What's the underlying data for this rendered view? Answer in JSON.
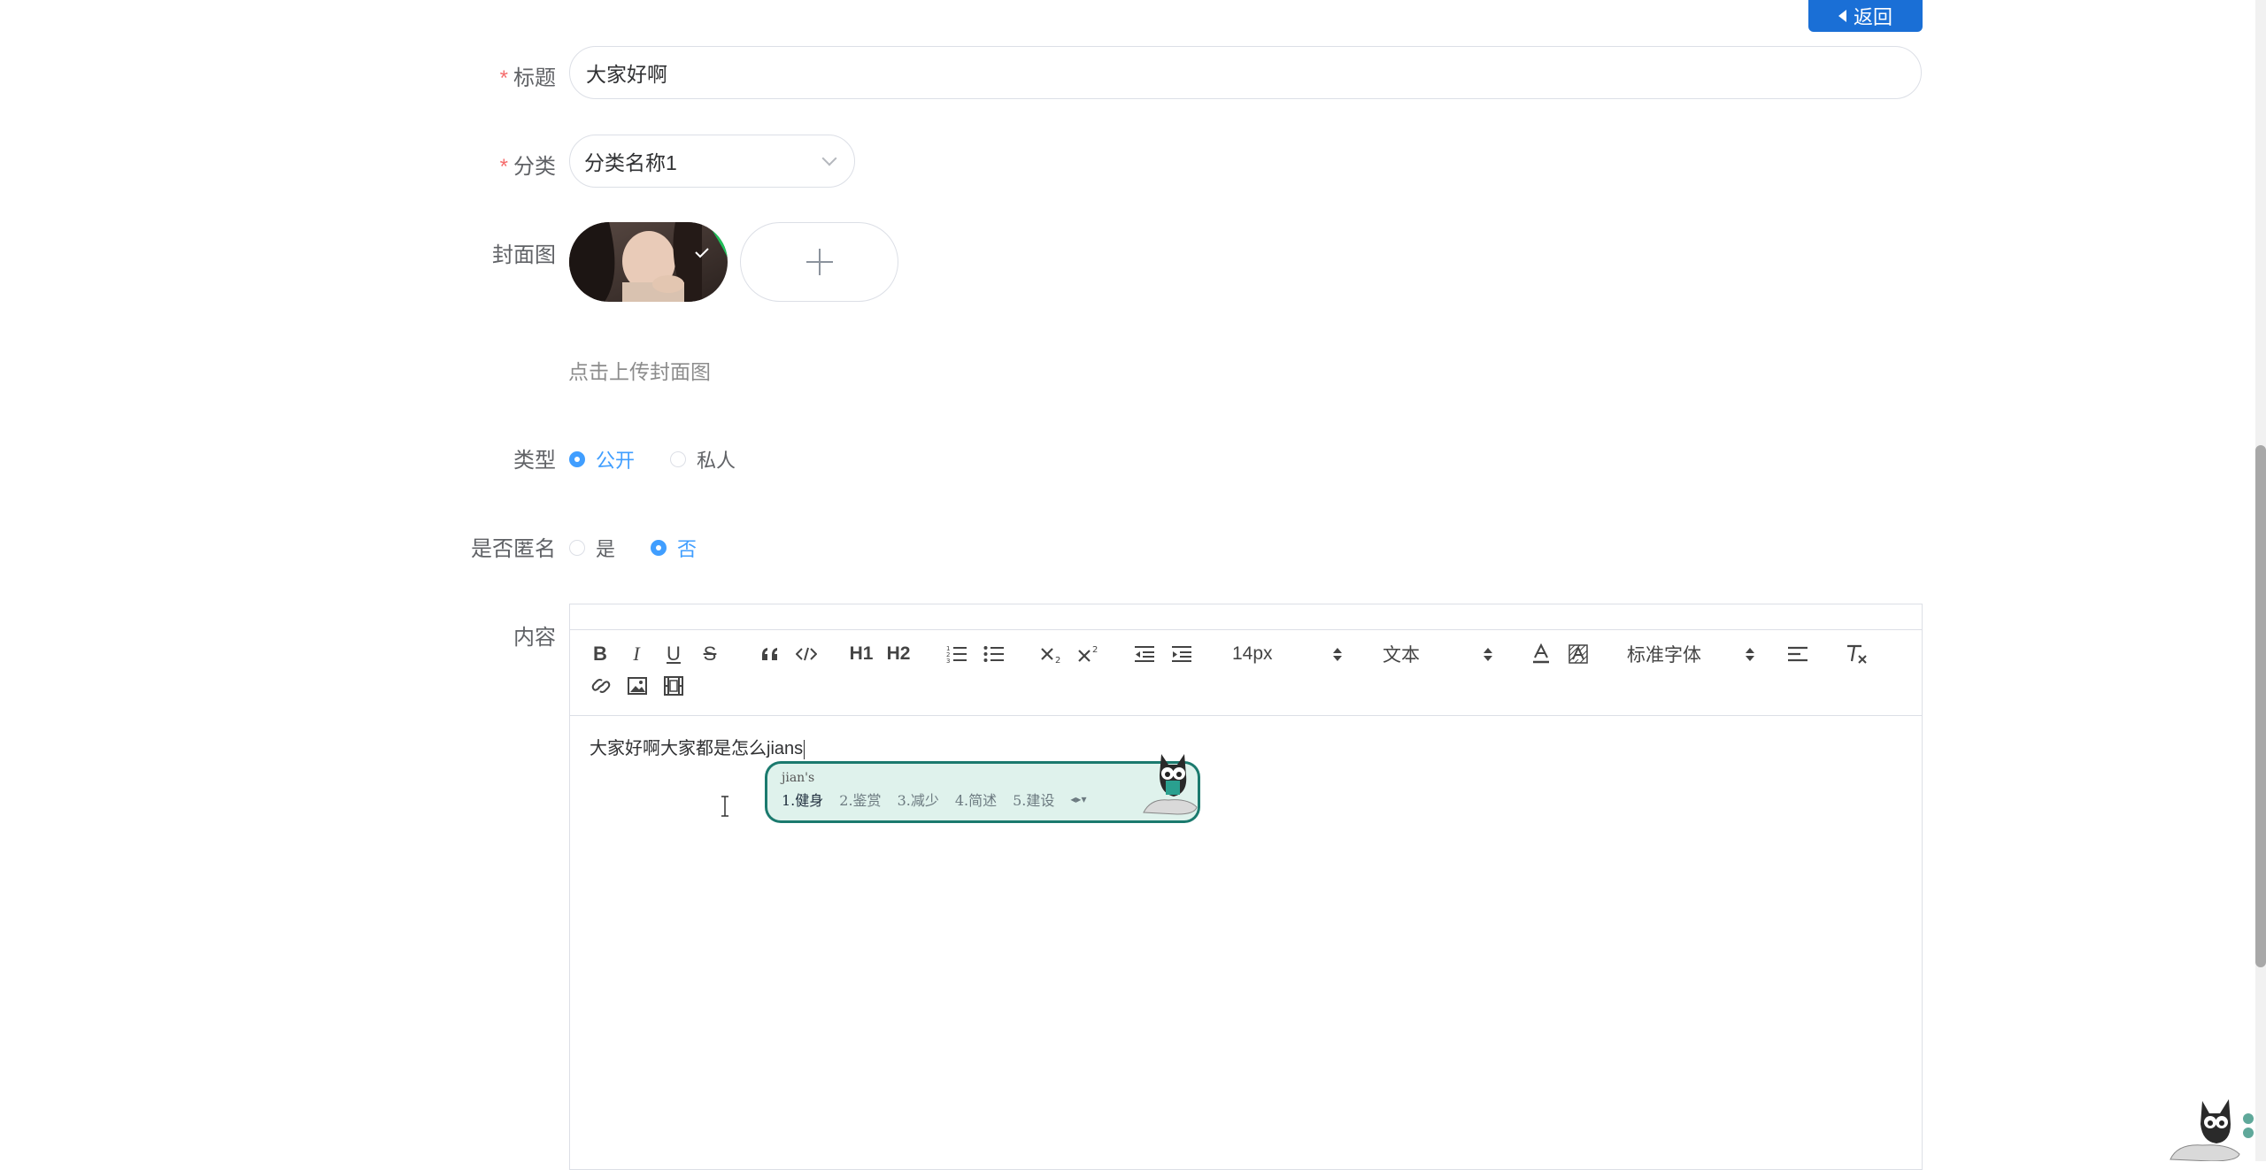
{
  "header": {
    "back_label": "返回"
  },
  "form": {
    "title": {
      "label": "标题",
      "required_mark": "*",
      "value": "大家好啊"
    },
    "category": {
      "label": "分类",
      "required_mark": "*",
      "value": "分类名称1"
    },
    "cover": {
      "label": "封面图",
      "hint": "点击上传封面图"
    },
    "type": {
      "label": "类型",
      "options": [
        "公开",
        "私人"
      ],
      "selected": "公开"
    },
    "anonymous": {
      "label": "是否匿名",
      "options": [
        "是",
        "否"
      ],
      "selected": "否"
    },
    "content": {
      "label": "内容",
      "text": "大家好啊大家都是怎么jians"
    }
  },
  "editor_toolbar": {
    "size_value": "14px",
    "header_value": "文本",
    "font_value": "标准字体",
    "h1_label": "H1",
    "h2_label": "H2",
    "bold_label": "B",
    "italic_label": "I",
    "underline_label": "U",
    "strike_label": "S"
  },
  "ime": {
    "composition": "jian's",
    "candidates": [
      "1.健身",
      "2.鉴赏",
      "3.减少",
      "4.简述",
      "5.建设"
    ]
  },
  "colors": {
    "primary": "#409eff",
    "back_button": "#1a6fd6",
    "required": "#f56c6c"
  }
}
